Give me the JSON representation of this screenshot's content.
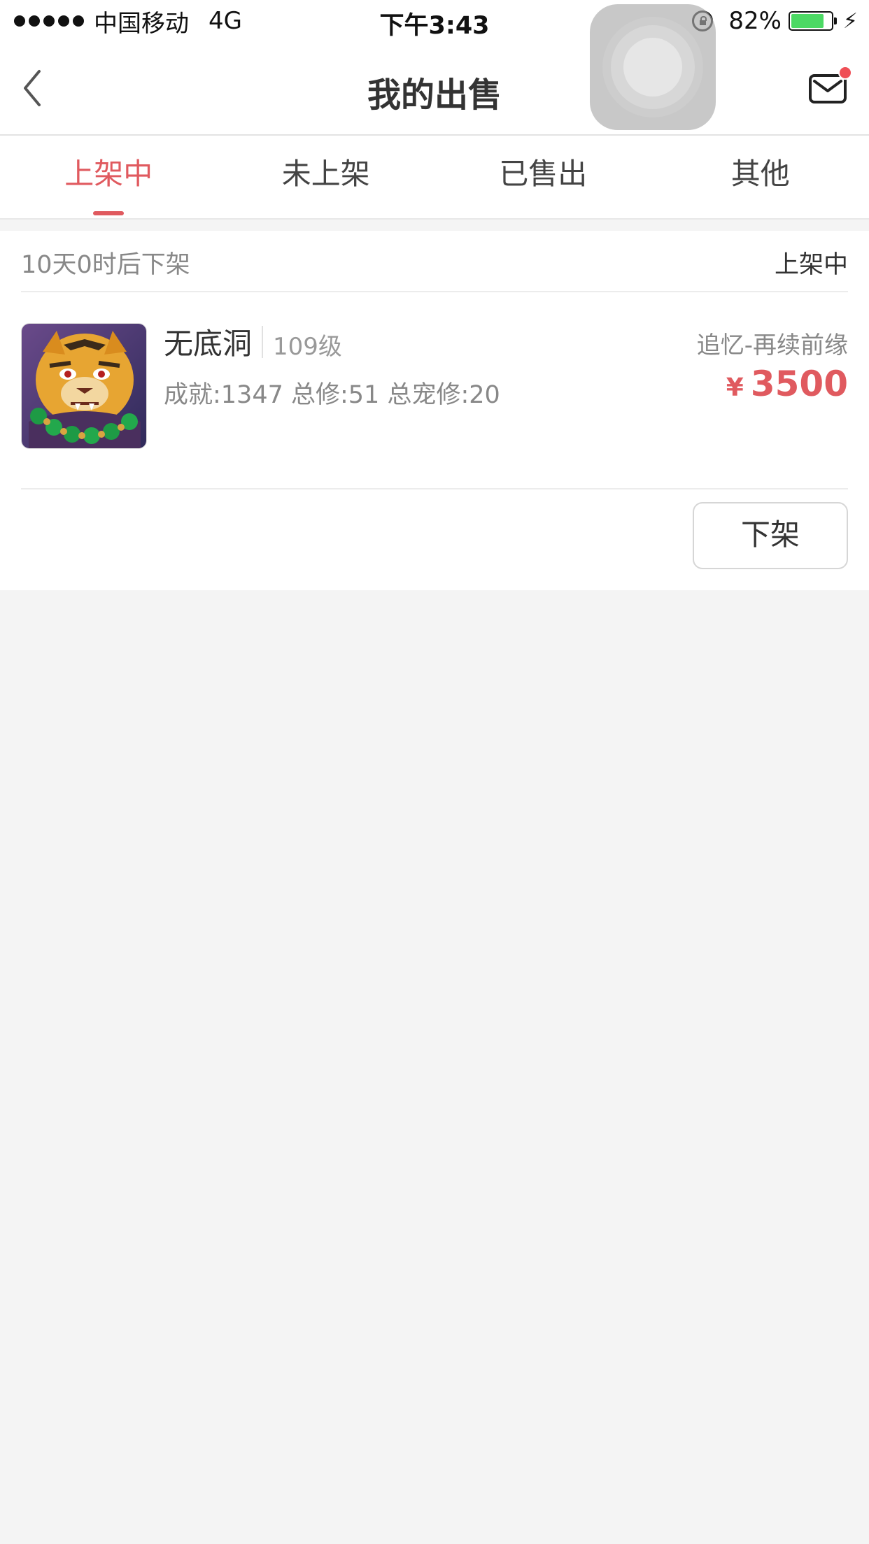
{
  "status_bar": {
    "carrier": "中国移动",
    "network": "4G",
    "time": "下午3:43",
    "battery_percent": "82%",
    "battery_level": 0.82,
    "battery_color": "#4cd964"
  },
  "nav": {
    "title": "我的出售",
    "back_icon": "chevron-left-icon",
    "mail_icon": "mail-icon",
    "mail_badge_color": "#ef4f56"
  },
  "tabs": [
    {
      "label": "上架中",
      "active": true
    },
    {
      "label": "未上架",
      "active": false
    },
    {
      "label": "已售出",
      "active": false
    },
    {
      "label": "其他",
      "active": false
    }
  ],
  "accent_color": "#e05a5f",
  "listing": {
    "expiry": "10天0时后下架",
    "status": "上架中",
    "name": "无底洞",
    "level": "109级",
    "stats": "成就:1347 总修:51 总宠修:20",
    "server": "追忆-再续前缘",
    "price_symbol": "¥",
    "price": "3500",
    "delist_button": "下架"
  }
}
